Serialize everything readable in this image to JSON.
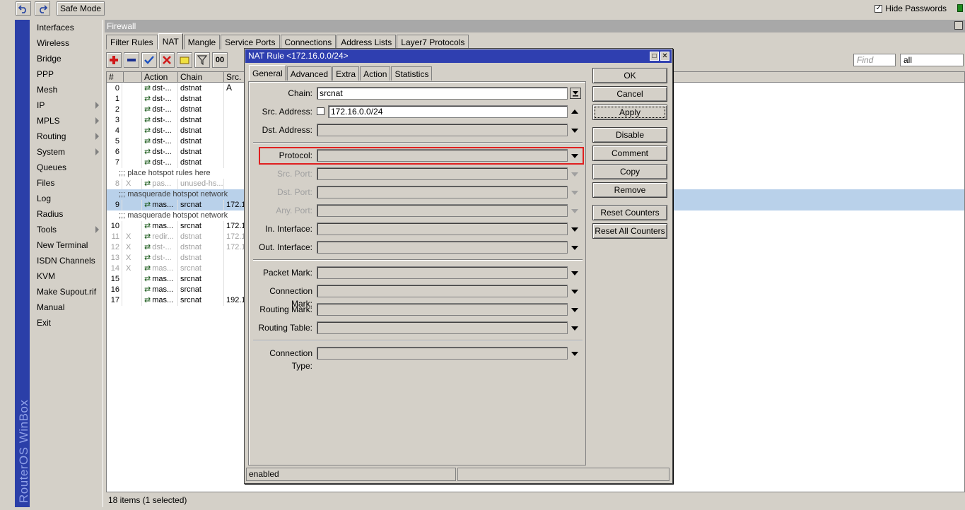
{
  "toolbar": {
    "safe_mode": "Safe Mode",
    "hide_passwords": "Hide Passwords",
    "hide_passwords_checked": "✓"
  },
  "brand": "RouterOS WinBox",
  "menu": [
    {
      "label": "Interfaces",
      "arrow": false
    },
    {
      "label": "Wireless",
      "arrow": false
    },
    {
      "label": "Bridge",
      "arrow": false
    },
    {
      "label": "PPP",
      "arrow": false
    },
    {
      "label": "Mesh",
      "arrow": false
    },
    {
      "label": "IP",
      "arrow": true
    },
    {
      "label": "MPLS",
      "arrow": true
    },
    {
      "label": "Routing",
      "arrow": true
    },
    {
      "label": "System",
      "arrow": true
    },
    {
      "label": "Queues",
      "arrow": false
    },
    {
      "label": "Files",
      "arrow": false
    },
    {
      "label": "Log",
      "arrow": false
    },
    {
      "label": "Radius",
      "arrow": false
    },
    {
      "label": "Tools",
      "arrow": true
    },
    {
      "label": "New Terminal",
      "arrow": false
    },
    {
      "label": "ISDN Channels",
      "arrow": false
    },
    {
      "label": "KVM",
      "arrow": false
    },
    {
      "label": "Make Supout.rif",
      "arrow": false
    },
    {
      "label": "Manual",
      "arrow": false
    },
    {
      "label": "Exit",
      "arrow": false
    }
  ],
  "firewall": {
    "title": "Firewall",
    "tabs": [
      "Filter Rules",
      "NAT",
      "Mangle",
      "Service Ports",
      "Connections",
      "Address Lists",
      "Layer7 Protocols"
    ],
    "active_tab": "NAT",
    "find_placeholder": "Find",
    "filter_value": "all",
    "columns": [
      "#",
      "",
      "Action",
      "Chain",
      "Src. A"
    ],
    "rows": [
      {
        "type": "rule",
        "num": "0",
        "flag": "",
        "action": "dst-...",
        "chain": "dstnat",
        "src": ""
      },
      {
        "type": "rule",
        "num": "1",
        "flag": "",
        "action": "dst-...",
        "chain": "dstnat",
        "src": ""
      },
      {
        "type": "rule",
        "num": "2",
        "flag": "",
        "action": "dst-...",
        "chain": "dstnat",
        "src": ""
      },
      {
        "type": "rule",
        "num": "3",
        "flag": "",
        "action": "dst-...",
        "chain": "dstnat",
        "src": ""
      },
      {
        "type": "rule",
        "num": "4",
        "flag": "",
        "action": "dst-...",
        "chain": "dstnat",
        "src": ""
      },
      {
        "type": "rule",
        "num": "5",
        "flag": "",
        "action": "dst-...",
        "chain": "dstnat",
        "src": ""
      },
      {
        "type": "rule",
        "num": "6",
        "flag": "",
        "action": "dst-...",
        "chain": "dstnat",
        "src": ""
      },
      {
        "type": "rule",
        "num": "7",
        "flag": "",
        "action": "dst-...",
        "chain": "dstnat",
        "src": ""
      },
      {
        "type": "comment",
        "text": ";;; place hotspot rules here"
      },
      {
        "type": "disabled",
        "num": "8",
        "flag": "X",
        "action": "pas...",
        "chain": "unused-hs...",
        "src": ""
      },
      {
        "type": "comment-selected",
        "text": ";;; masquerade hotspot network"
      },
      {
        "type": "selected",
        "num": "9",
        "flag": "",
        "action": "mas...",
        "chain": "srcnat",
        "src": "172.1"
      },
      {
        "type": "comment",
        "text": ";;; masquerade hotspot network"
      },
      {
        "type": "rule",
        "num": "10",
        "flag": "",
        "action": "mas...",
        "chain": "srcnat",
        "src": "172.1"
      },
      {
        "type": "disabled",
        "num": "11",
        "flag": "X",
        "action": "redir...",
        "chain": "dstnat",
        "src": "172.1"
      },
      {
        "type": "disabled",
        "num": "12",
        "flag": "X",
        "action": "dst-...",
        "chain": "dstnat",
        "src": "172.1"
      },
      {
        "type": "disabled",
        "num": "13",
        "flag": "X",
        "action": "dst-...",
        "chain": "dstnat",
        "src": ""
      },
      {
        "type": "disabled",
        "num": "14",
        "flag": "X",
        "action": "mas...",
        "chain": "srcnat",
        "src": ""
      },
      {
        "type": "rule",
        "num": "15",
        "flag": "",
        "action": "mas...",
        "chain": "srcnat",
        "src": ""
      },
      {
        "type": "rule",
        "num": "16",
        "flag": "",
        "action": "mas...",
        "chain": "srcnat",
        "src": ""
      },
      {
        "type": "rule",
        "num": "17",
        "flag": "",
        "action": "mas...",
        "chain": "srcnat",
        "src": "192.1"
      }
    ],
    "status": "18 items (1 selected)"
  },
  "dialog": {
    "title": "NAT Rule <172.16.0.0/24>",
    "tabs": [
      "General",
      "Advanced",
      "Extra",
      "Action",
      "Statistics"
    ],
    "active_tab": "General",
    "fields": {
      "chain_label": "Chain:",
      "chain_value": "srcnat",
      "src_address_label": "Src. Address:",
      "src_address_value": "172.16.0.0/24",
      "dst_address_label": "Dst. Address:",
      "protocol_label": "Protocol:",
      "src_port_label": "Src. Port:",
      "dst_port_label": "Dst. Port:",
      "any_port_label": "Any. Port:",
      "in_interface_label": "In. Interface:",
      "out_interface_label": "Out. Interface:",
      "packet_mark_label": "Packet Mark:",
      "connection_mark_label": "Connection Mark:",
      "routing_mark_label": "Routing Mark:",
      "routing_table_label": "Routing Table:",
      "connection_type_label": "Connection Type:"
    },
    "buttons": {
      "ok": "OK",
      "cancel": "Cancel",
      "apply": "Apply",
      "disable": "Disable",
      "comment": "Comment",
      "copy": "Copy",
      "remove": "Remove",
      "reset_counters": "Reset Counters",
      "reset_all_counters": "Reset All Counters"
    },
    "status": "enabled"
  }
}
